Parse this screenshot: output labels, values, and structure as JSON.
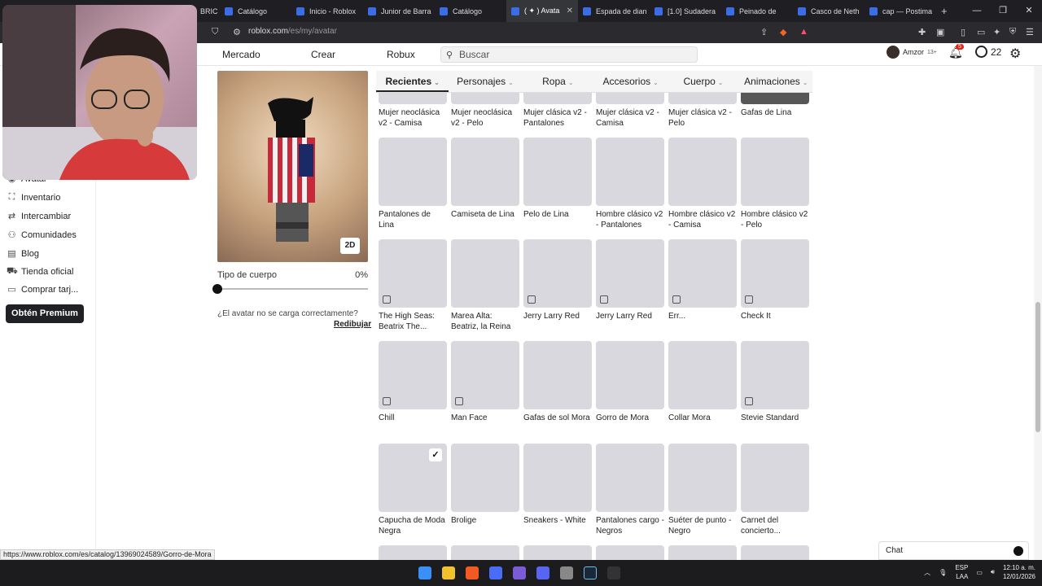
{
  "browser": {
    "tabs": [
      {
        "title": "BRIC"
      },
      {
        "title": "Catálogo"
      },
      {
        "title": "Inicio - Roblox"
      },
      {
        "title": "Junior de Barra"
      },
      {
        "title": "Catálogo"
      },
      {
        "title": "( ✦ ) Avata"
      },
      {
        "title": "Espada de dian"
      },
      {
        "title": "[1.0] Sudadera"
      },
      {
        "title": "Peinado de"
      },
      {
        "title": "Casco de Neth"
      },
      {
        "title": "cap — Postima"
      }
    ],
    "active_tab_index": 5,
    "new_tab": "+",
    "url_host": "roblox.com",
    "url_path": "/es/my/avatar"
  },
  "nav": {
    "market": "Mercado",
    "create": "Crear",
    "robux": "Robux",
    "search_placeholder": "Buscar",
    "username": "Amzor",
    "age": "13+",
    "notifications": "5",
    "robux_count": "22"
  },
  "sidebar": {
    "items": [
      {
        "label": "Avatar",
        "icon": "avatar-icon"
      },
      {
        "label": "Inventario",
        "icon": "inventory-icon"
      },
      {
        "label": "Intercambiar",
        "icon": "trade-icon"
      },
      {
        "label": "Comunidades",
        "icon": "communities-icon"
      },
      {
        "label": "Blog",
        "icon": "blog-icon"
      },
      {
        "label": "Tienda oficial",
        "icon": "store-icon"
      },
      {
        "label": "Comprar tarj...",
        "icon": "gift-card-icon"
      }
    ],
    "premium": "Obtén Premium"
  },
  "avatar": {
    "btn_2d": "2D",
    "body_type_label": "Tipo de cuerpo",
    "body_type_value": "0%",
    "load_question": "¿El avatar no se carga correctamente?",
    "redraw": "Redibujar"
  },
  "categories": [
    {
      "label": "Recientes"
    },
    {
      "label": "Personajes"
    },
    {
      "label": "Ropa"
    },
    {
      "label": "Accesorios"
    },
    {
      "label": "Cuerpo"
    },
    {
      "label": "Animaciones"
    }
  ],
  "items": [
    [
      {
        "name": "Mujer neoclásica v2 - Camisa"
      },
      {
        "name": "Mujer neoclásica v2 - Pelo"
      },
      {
        "name": "Mujer clásica v2 - Pantalones"
      },
      {
        "name": "Mujer clásica v2 - Camisa"
      },
      {
        "name": "Mujer clásica v2 - Pelo"
      },
      {
        "name": "Gafas de Lina"
      }
    ],
    [
      {
        "name": "Pantalones de Lina"
      },
      {
        "name": "Camiseta de Lina"
      },
      {
        "name": "Pelo de Lina"
      },
      {
        "name": "Hombre clásico v2 - Pantalones"
      },
      {
        "name": "Hombre clásico v2 - Camisa"
      },
      {
        "name": "Hombre clásico v2 - Pelo"
      }
    ],
    [
      {
        "name": "The High Seas: Beatrix The..."
      },
      {
        "name": "Marea Alta: Beatriz, la Reina de los..."
      },
      {
        "name": "Jerry Larry Red"
      },
      {
        "name": "Jerry Larry Red"
      },
      {
        "name": "Err..."
      },
      {
        "name": "Check It"
      }
    ],
    [
      {
        "name": "Chill"
      },
      {
        "name": "Man Face"
      },
      {
        "name": "Gafas de sol Mora"
      },
      {
        "name": "Gorro de Mora"
      },
      {
        "name": "Collar Mora"
      },
      {
        "name": "Stevie Standard"
      }
    ],
    [
      {
        "name": "Capucha de Moda Negra"
      },
      {
        "name": "Brolige"
      },
      {
        "name": "Sneakers - White"
      },
      {
        "name": "Pantalones cargo - Negros"
      },
      {
        "name": "Suéter de punto - Negro"
      },
      {
        "name": "Carnet del concierto..."
      }
    ]
  ],
  "status_url": "https://www.roblox.com/es/catalog/13969024589/Gorro-de-Mora",
  "chat_label": "Chat",
  "taskbar": {
    "lang1": "ESP",
    "lang2": "LAA",
    "time": "12:10 a. m.",
    "date": "12/01/2026"
  },
  "colors": {
    "accent": "#202124",
    "thumb_bg": "#d8d8de",
    "tab_bar": "#1f1f23"
  }
}
